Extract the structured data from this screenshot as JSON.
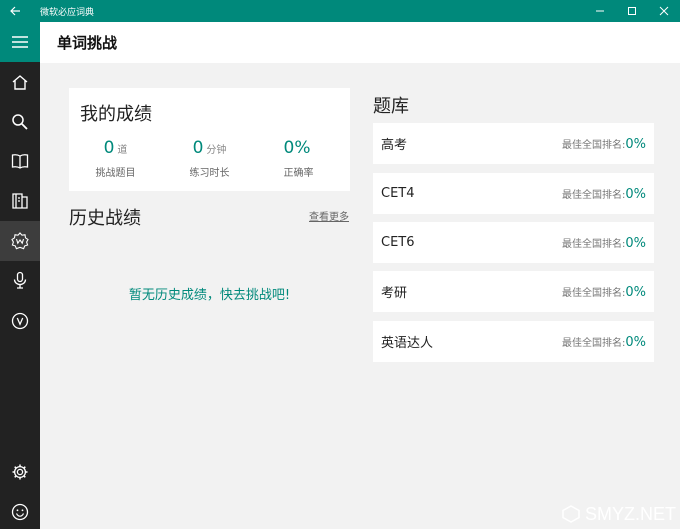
{
  "window": {
    "title": "微软必应词典"
  },
  "header": {
    "title": "单词挑战"
  },
  "score": {
    "title": "我的成绩",
    "stats": [
      {
        "value": "0",
        "unit": "道",
        "label": "挑战题目"
      },
      {
        "value": "0",
        "unit": "分钟",
        "label": "练习时长"
      },
      {
        "value": "0%",
        "unit": "",
        "label": "正确率"
      }
    ]
  },
  "history": {
    "title": "历史战绩",
    "more": "查看更多",
    "empty": "暂无历史成绩，快去挑战吧!"
  },
  "bank": {
    "title": "题库",
    "rank_label": "最佳全国排名:",
    "items": [
      {
        "name": "高考",
        "rank": "0%"
      },
      {
        "name": "CET4",
        "rank": "0%"
      },
      {
        "name": "CET6",
        "rank": "0%"
      },
      {
        "name": "考研",
        "rank": "0%"
      },
      {
        "name": "英语达人",
        "rank": "0%"
      }
    ]
  },
  "watermark": {
    "text": "SMYZ.NET"
  },
  "colors": {
    "accent": "#00897b",
    "sidebar": "#222222",
    "background": "#f2f2f2"
  },
  "icons": [
    "back-arrow-icon",
    "minimize-icon",
    "maximize-icon",
    "close-icon",
    "hamburger-icon",
    "home-icon",
    "search-icon",
    "book-icon",
    "notebook-icon",
    "word-challenge-icon",
    "microphone-icon",
    "video-icon",
    "settings-icon",
    "smiley-icon"
  ]
}
